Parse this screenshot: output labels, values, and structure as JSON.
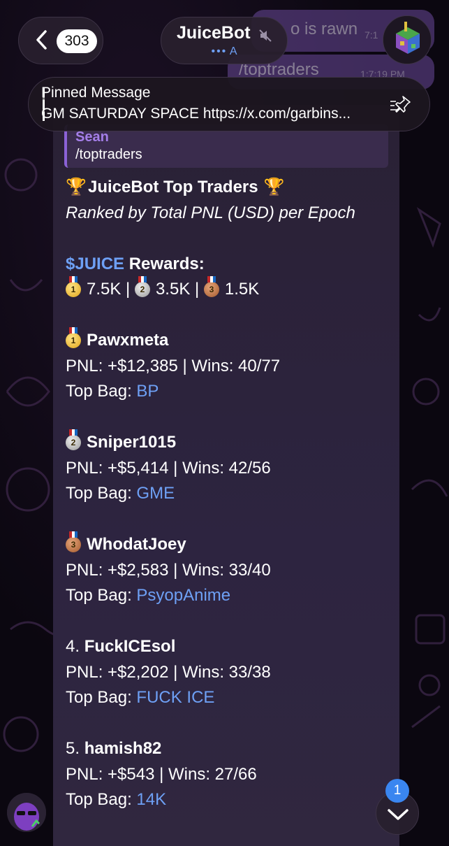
{
  "header": {
    "back_count": "303",
    "chat_title": "JuiceBot",
    "chat_status": "A"
  },
  "outgoing": {
    "msg1_text": "o is rawn",
    "msg1_time": "7:1",
    "msg2_text": "/toptraders",
    "msg2_time": "1:7:19 PM"
  },
  "pinned": {
    "title": "Pinned Message",
    "text": "GM SATURDAY SPACE https://x.com/garbins..."
  },
  "message": {
    "reply_name": "Sean",
    "reply_text": "/toptraders",
    "title": "JuiceBot Top Traders",
    "subtitle": "Ranked by Total PNL (USD) per Epoch",
    "rewards_token": "$JUICE",
    "rewards_label": " Rewards:",
    "reward_gold": "7.5K",
    "reward_silver": "3.5K",
    "reward_bronze": "1.5K",
    "top_bag_label": "Top Bag: ",
    "traders": [
      {
        "rank": "",
        "name": "Pawxmeta",
        "pnl_line": "PNL: +$12,385 | Wins: 40/77",
        "top_bag": "BP"
      },
      {
        "rank": "",
        "name": "Sniper1015",
        "pnl_line": "PNL: +$5,414 | Wins: 42/56",
        "top_bag": "GME"
      },
      {
        "rank": "",
        "name": "WhodatJoey",
        "pnl_line": "PNL: +$2,583 | Wins: 33/40",
        "top_bag": "PsyopAnime"
      },
      {
        "rank": "4. ",
        "name": "FuckICEsol",
        "pnl_line": "PNL: +$2,202 | Wins: 33/38",
        "top_bag": "FUCK ICE"
      },
      {
        "rank": "5. ",
        "name": "hamish82",
        "pnl_line": "PNL: +$543 | Wins: 27/66",
        "top_bag": "14K"
      }
    ]
  },
  "scroll": {
    "unread_count": "1"
  },
  "colors": {
    "link": "#6ea0f5",
    "reply_accent": "#8b62d6",
    "badge": "#3a86f0"
  },
  "icons": [
    "back-chevron-icon",
    "mute-icon",
    "pin-icon",
    "trophy-icon",
    "gold-medal-icon",
    "silver-medal-icon",
    "bronze-medal-icon",
    "chevron-down-icon"
  ]
}
